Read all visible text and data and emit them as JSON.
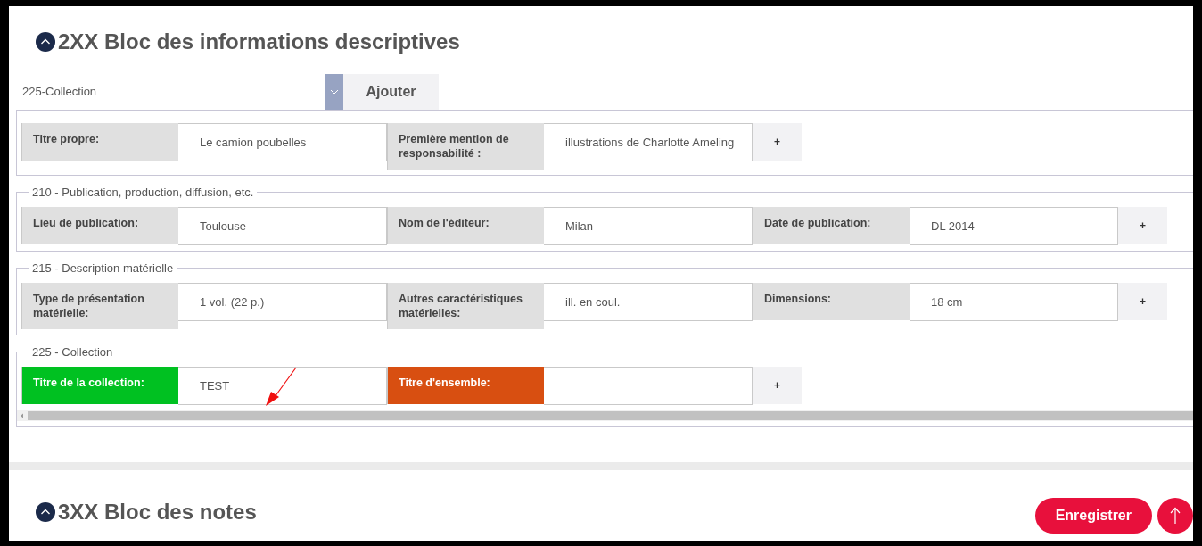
{
  "block": {
    "title": "2XX Bloc des informations descriptives",
    "expanded": true
  },
  "add_row": {
    "select_value": "225-Collection",
    "button": "Ajouter"
  },
  "fieldsets": [
    {
      "fields": [
        {
          "label": "Titre propre:",
          "value": "Le camion poubelles",
          "color": "#e0e0e0"
        },
        {
          "label": "Première mention de responsabilité :",
          "value": "illustrations de Charlotte Ameling",
          "color": "#e0e0e0"
        }
      ],
      "plus": "+"
    },
    {
      "legend": "210 - Publication, production, diffusion, etc.",
      "fields": [
        {
          "label": "Lieu de publication:",
          "value": "Toulouse",
          "color": "#e0e0e0"
        },
        {
          "label": "Nom de l'éditeur:",
          "value": "Milan",
          "color": "#e0e0e0"
        },
        {
          "label": "Date de publication:",
          "value": "DL 2014",
          "color": "#e0e0e0"
        }
      ],
      "plus": "+"
    },
    {
      "legend": "215 - Description matérielle",
      "fields": [
        {
          "label": "Type de présentation matérielle:",
          "value": "1 vol. (22 p.)",
          "color": "#e0e0e0"
        },
        {
          "label": "Autres caractéristiques matérielles:",
          "value": "ill. en coul.",
          "color": "#e0e0e0"
        },
        {
          "label": "Dimensions:",
          "value": "18 cm",
          "color": "#e0e0e0"
        }
      ],
      "plus": "+"
    },
    {
      "legend": "225 - Collection",
      "fields": [
        {
          "label": "Titre de la collection:",
          "value": "TEST",
          "color": "#00c121"
        },
        {
          "label": "Titre d'ensemble:",
          "color": "#d84f11"
        }
      ],
      "plus": "+"
    }
  ],
  "next_block": {
    "title": "3XX Bloc des notes",
    "expanded": true
  },
  "save_button": "Enregistrer"
}
